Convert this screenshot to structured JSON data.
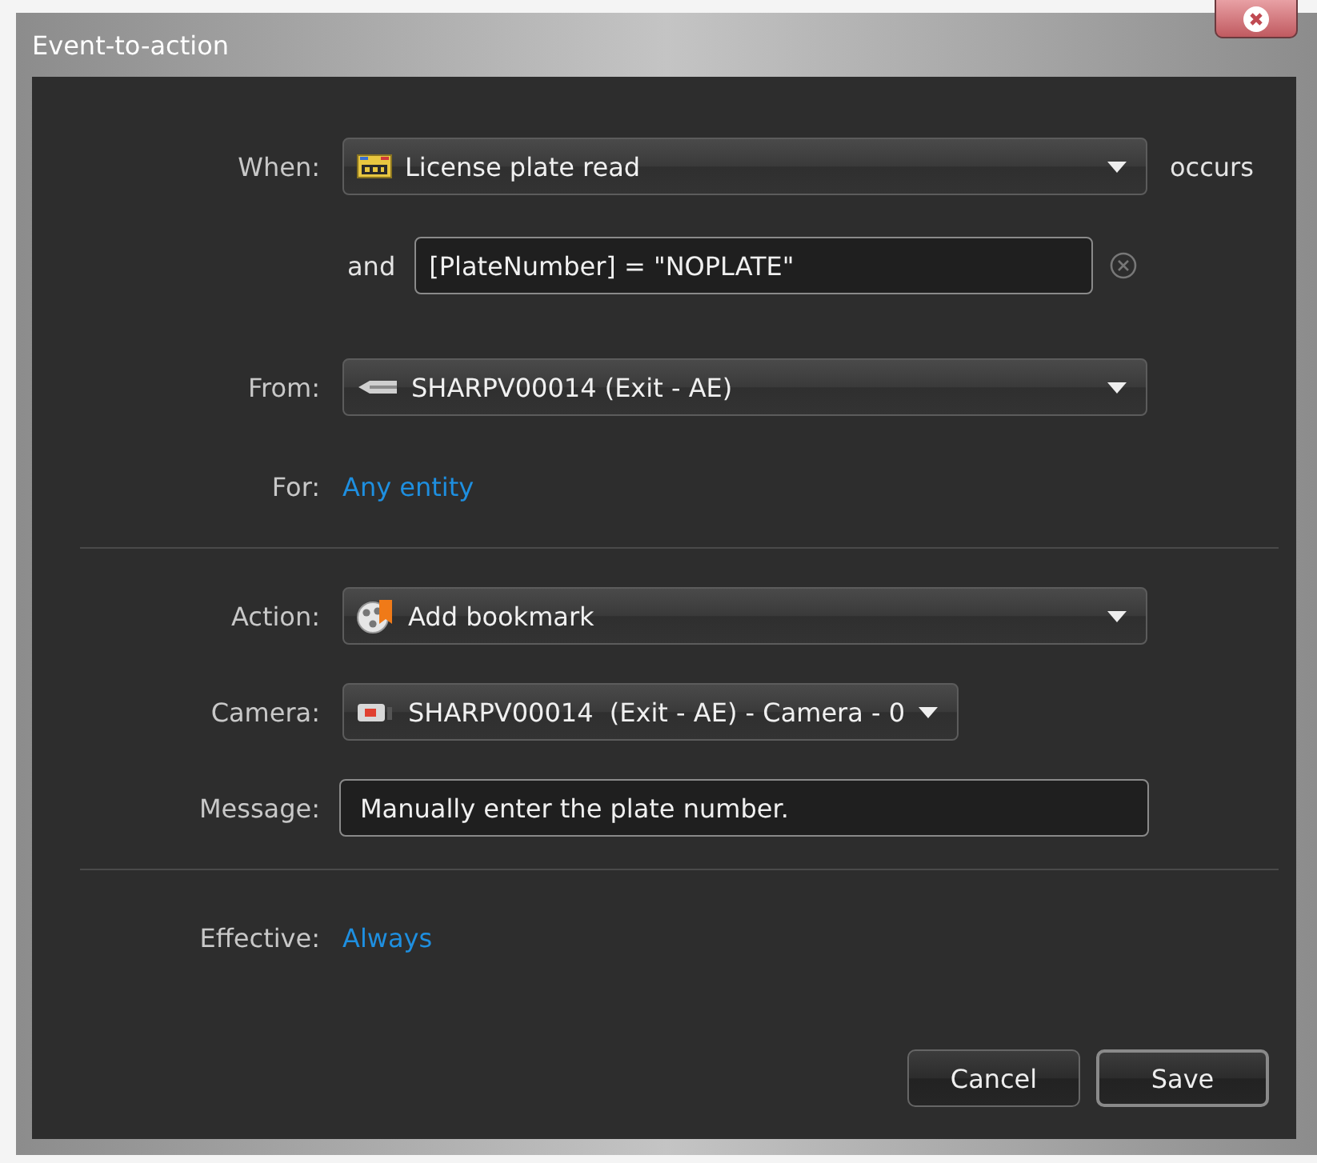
{
  "window": {
    "title": "Event-to-action"
  },
  "when": {
    "label": "When:",
    "value": "License plate read",
    "suffix": "occurs"
  },
  "condition": {
    "label": "and",
    "value": "[PlateNumber] = \"NOPLATE\""
  },
  "from": {
    "label": "From:",
    "value": "SHARPV00014 (Exit - AE)"
  },
  "for": {
    "label": "For:",
    "link": "Any entity"
  },
  "action": {
    "label": "Action:",
    "value": "Add bookmark"
  },
  "camera": {
    "label": "Camera:",
    "value": "SHARPV00014  (Exit - AE) - Camera - 0"
  },
  "message": {
    "label": "Message:",
    "value": "Manually enter the plate number."
  },
  "effective": {
    "label": "Effective:",
    "link": "Always"
  },
  "buttons": [
    "Cancel",
    "Save"
  ]
}
